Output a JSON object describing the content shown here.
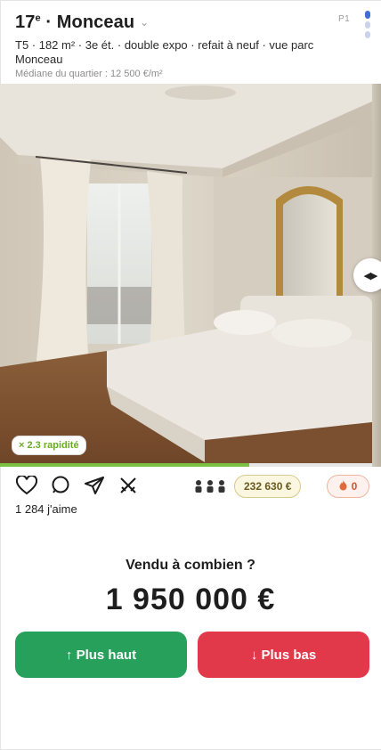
{
  "listing": {
    "arrondissement": "17",
    "arrondissement_suffix": "e",
    "district": "· Monceau",
    "description": "T5 · 182 m² · 3e ét. · double expo · refait à neuf · vue parc Monceau",
    "median": "Médiane du quartier : 12 500 €/m²"
  },
  "pager": {
    "label": "P1",
    "dots": 3,
    "active": 0
  },
  "photo": {
    "speed_badge": "× 2.3 rapidité",
    "progress": 0.67
  },
  "social": {
    "likes": "1 284 j'aime",
    "people_icon": "•••",
    "guess_price": "232 630 €",
    "fire_count": "0"
  },
  "question": {
    "label": "Vendu à combien ?",
    "price": "1 950 000 €"
  },
  "buttons": {
    "higher": "↑ Plus haut",
    "lower": "↓ Plus bas"
  },
  "colors": {
    "higher": "#27a05c",
    "lower": "#e2394a",
    "progress": "#7dc143",
    "accent": "#3d6fd6"
  }
}
